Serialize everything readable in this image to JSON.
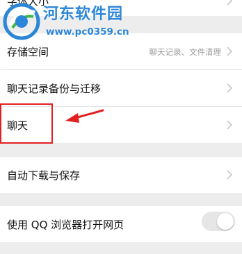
{
  "settings": {
    "font_size_label": "字体大小",
    "storage": {
      "label": "存储空间",
      "detail": "聊天记录、文件清理"
    },
    "backup_label": "聊天记录备份与迁移",
    "chat_label": "聊天",
    "auto_download_label": "自动下载与保存",
    "browser": {
      "label": "使用 QQ 浏览器打开网页",
      "toggle_on": false
    }
  },
  "watermark": {
    "title": "河东软件园",
    "url": "www.pc0359.cn"
  },
  "annotation": {
    "color": "#e41f1f"
  },
  "icons": {
    "chevron": "chevron-right-icon",
    "logo": "watermark-logo-icon"
  }
}
